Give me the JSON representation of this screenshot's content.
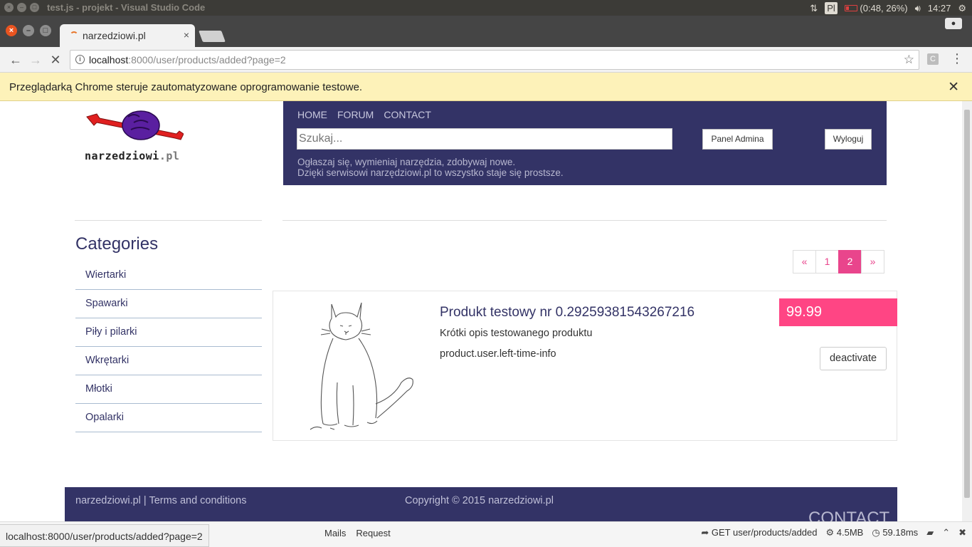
{
  "os": {
    "window_title": "test.js - projekt - Visual Studio Code",
    "keyboard": "Pl",
    "battery": "(0:48, 26%)",
    "clock": "14:27"
  },
  "browser": {
    "tab_title": "narzedziowi.pl",
    "url_host": "localhost",
    "url_path": ":8000/user/products/added?page=2",
    "ext_label": "C",
    "infobar_text": "Przeglądarką Chrome steruje zautomatyzowane oprogramowanie testowe."
  },
  "site": {
    "logo_text": "narzedziowi",
    "logo_suffix": ".pl",
    "nav": [
      "HOME",
      "FORUM",
      "CONTACT"
    ],
    "search_placeholder": "Szukaj...",
    "admin_button": "Panel Admina",
    "logout_button": "Wyloguj",
    "tagline_1": "Ogłaszaj się, wymieniaj narzędzia, zdobywaj nowe.",
    "tagline_2": "Dzięki serwisowi narzędziowi.pl to wszystko staje się prostsze."
  },
  "categories": {
    "title": "Categories",
    "items": [
      "Wiertarki",
      "Spawarki",
      "Piły i pilarki",
      "Wkrętarki",
      "Młotki",
      "Opalarki"
    ]
  },
  "pagination": {
    "prev": "«",
    "pages": [
      "1",
      "2"
    ],
    "active": "2",
    "next": "»"
  },
  "product": {
    "title": "Produkt testowy nr 0.29259381543267216",
    "description": "Krótki opis testowanego produktu",
    "info": "product.user.left-time-info",
    "price": "99.99",
    "action": "deactivate"
  },
  "footer": {
    "left": "narzedziowi.pl | Terms and conditions",
    "copyright": "Copyright © 2015 narzedziowi.pl",
    "contact": "CONTACT"
  },
  "status_bar": {
    "hover_url": "localhost:8000/user/products/added?page=2",
    "tab_mails": "Mails",
    "tab_request": "Request",
    "route": "GET user/products/added",
    "memory": "4.5MB",
    "time": "59.18ms"
  },
  "colors": {
    "header_bg": "#333366",
    "accent_pink": "#ff4584",
    "infobar_bg": "#fdf2b9"
  }
}
